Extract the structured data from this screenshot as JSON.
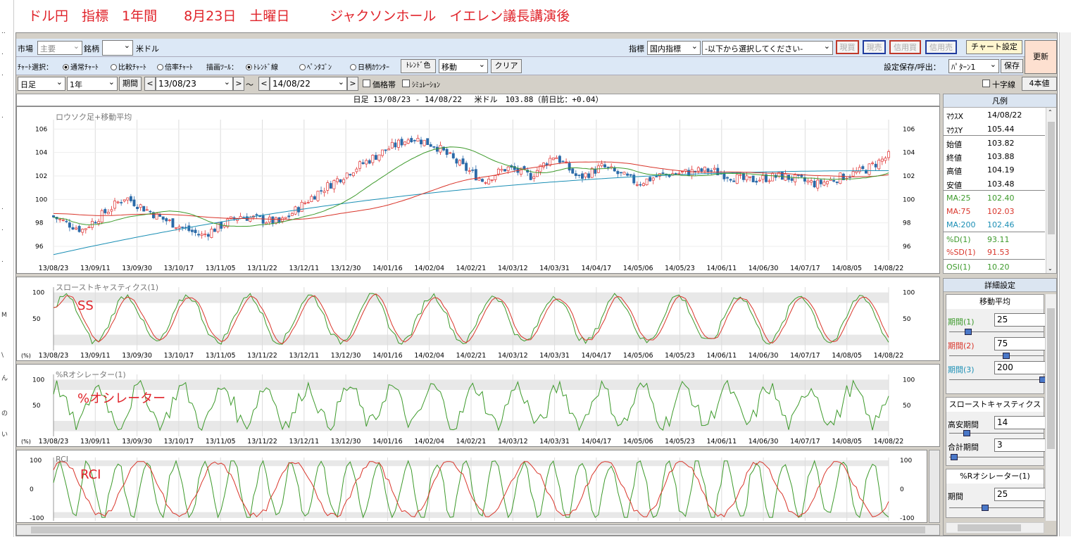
{
  "title": "ドル円　指標　1年間　　8月23日　土曜日　　　ジャクソンホール　イエレン議長講演後",
  "toolbar1": {
    "market_label": "市場",
    "market_value": "主要",
    "symbol_label": "銘柄",
    "symbol_value": "",
    "symbol_unit": "米ドル",
    "indicator_label": "指標",
    "indicator_value": "国内指標",
    "indicator_select": "-以下から選択してください-",
    "btn_genkai": "現買",
    "btn_genbai": "現売",
    "btn_shinkai": "信用買",
    "btn_shinbai": "信用売",
    "chart_settings": "チャート設定",
    "refresh": "更新"
  },
  "toolbar2": {
    "chart_select_label": "ﾁｬｰﾄ選択：",
    "opt_normal": "通常ﾁｬｰﾄ",
    "opt_compare": "比較ﾁｬｰﾄ",
    "opt_ratio": "倍率ﾁｬｰﾄ",
    "draw_tool_label": "描画ﾂｰﾙ：",
    "opt_trend": "ﾄﾚﾝﾄﾞ線",
    "opt_pentagon": "ﾍﾟﾝﾀｺﾞﾝ",
    "opt_daycounter": "日柄ｶｳﾝﾀｰ",
    "trend_color": "ﾄﾚﾝﾄﾞ色",
    "move_value": "移動",
    "clear": "クリア",
    "save_label": "設定保存/呼出：",
    "pattern_value": "ﾊﾟﾀｰﾝ1",
    "save_btn": "保存"
  },
  "toolbar3": {
    "period_type": "日足",
    "period_len": "1年",
    "period_btn": "期間",
    "date_from": "13/08/23",
    "range_sep": "〜",
    "date_to": "14/08/22",
    "price_band": "価格帯",
    "simulation": "ｼﾐｭﾚｰｼｮﾝ",
    "crosshair": "十字線",
    "four_values": "4本値"
  },
  "header_text": "日足 13/08/23 - 14/08/22　 米ドル　103.88（前日比：+0.04）",
  "x_labels": [
    "13/08/23",
    "13/09/11",
    "13/09/30",
    "13/10/17",
    "13/11/05",
    "13/11/22",
    "13/12/11",
    "13/12/30",
    "14/01/16",
    "14/02/04",
    "14/02/21",
    "14/03/12",
    "14/03/31",
    "14/04/17",
    "14/05/06",
    "14/05/23",
    "14/06/11",
    "14/06/30",
    "14/07/17",
    "14/08/05",
    "14/08/22"
  ],
  "panels": {
    "candle": {
      "title": "ロウソク足+移動平均",
      "yticks": [
        "106",
        "104",
        "102",
        "100",
        "98",
        "96"
      ]
    },
    "ss": {
      "title": "スローストキャスティクス(1)",
      "annotation": "SS",
      "yticks": [
        "100",
        "50"
      ],
      "pct": "(%)"
    },
    "r": {
      "title": "%Rオシレーター(1)",
      "annotation": "%オシレーター",
      "yticks": [
        "100",
        "50"
      ],
      "pct": "(%)"
    },
    "rci": {
      "title": "RCI",
      "annotation": "RCI",
      "yticks": [
        "100",
        "0",
        "-100"
      ]
    }
  },
  "legend": {
    "head": "凡例",
    "rows": [
      {
        "k": "ﾏｳｽX",
        "v": "14/08/22",
        "c": "#000"
      },
      {
        "k": "ﾏｳｽY",
        "v": "105.44",
        "c": "#000"
      },
      {
        "k": "始値",
        "v": "103.82",
        "c": "#000"
      },
      {
        "k": "終値",
        "v": "103.88",
        "c": "#000"
      },
      {
        "k": "高値",
        "v": "104.19",
        "c": "#000"
      },
      {
        "k": "安値",
        "v": "103.48",
        "c": "#000"
      },
      {
        "k": "MA:25",
        "v": "102.40",
        "c": "#3d9a2b"
      },
      {
        "k": "MA:75",
        "v": "102.03",
        "c": "#d9352a"
      },
      {
        "k": "MA:200",
        "v": "102.46",
        "c": "#1b8fb5"
      },
      {
        "k": "%D(1)",
        "v": "93.11",
        "c": "#3d9a2b"
      },
      {
        "k": "%SD(1)",
        "v": "91.53",
        "c": "#d9352a"
      },
      {
        "k": "OSI(1)",
        "v": "10.20",
        "c": "#3d9a2b"
      }
    ]
  },
  "detail": {
    "head": "詳細設定",
    "ma_head": "移動平均",
    "ma_p1_label": "期間(1)",
    "ma_p1": "25",
    "ma_p2_label": "期間(2)",
    "ma_p2": "75",
    "ma_p3_label": "期間(3)",
    "ma_p3": "200",
    "ss_head": "スローストキャスティクス",
    "ss_high_low_label": "高安期間",
    "ss_high_low": "14",
    "ss_total_label": "合計期間",
    "ss_total": "3",
    "r_head": "%Rオシレーター(1)",
    "r_period_label": "期間",
    "r_period": "25"
  },
  "left_strip": [
    "..",
    ".",
    ".",
    ".",
    ".",
    ".",
    ".",
    "M",
    "\\",
    "ん",
    "の",
    "い"
  ],
  "colors": {
    "ma25": "#3d9a2b",
    "ma75": "#d9352a",
    "ma200": "#1b8fb5",
    "up": "#e03030",
    "down": "#2b6aa8",
    "band": "#e8e8e8"
  }
}
